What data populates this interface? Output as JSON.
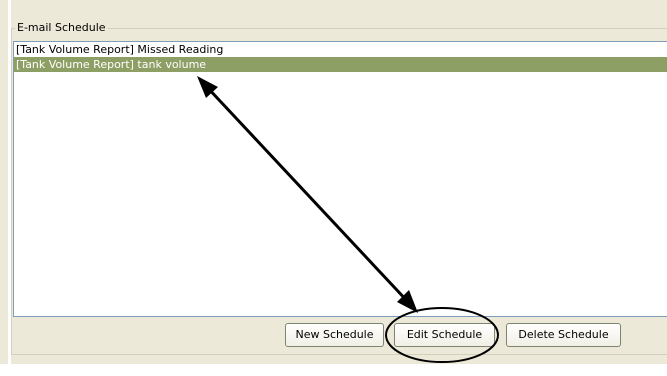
{
  "group": {
    "title": "E-mail Schedule"
  },
  "list": {
    "items": [
      {
        "label": "[Tank Volume Report] Missed Reading",
        "selected": false
      },
      {
        "label": "[Tank Volume Report] tank volume",
        "selected": true
      }
    ]
  },
  "buttons": {
    "new_label": "New Schedule",
    "edit_label": "Edit Schedule",
    "delete_label": "Delete Schedule"
  },
  "colors": {
    "selection": "#8e9f65",
    "annotation": "#000000"
  },
  "annotation": {
    "arrow": "double-headed-arrow",
    "highlight": "ellipse"
  }
}
